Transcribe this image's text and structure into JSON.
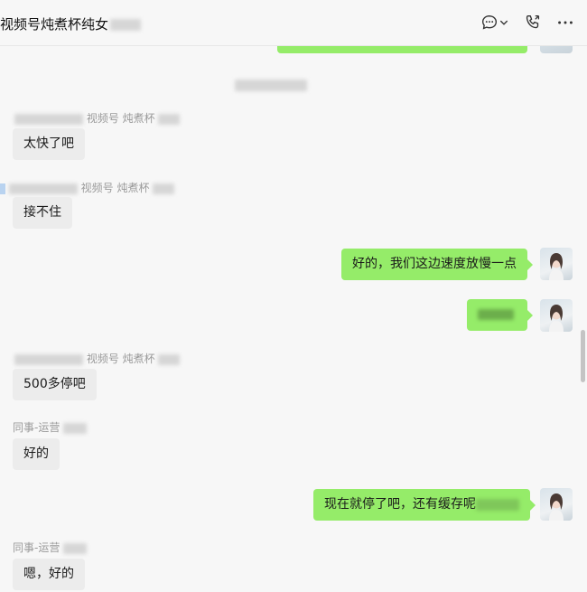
{
  "header": {
    "title": "视频号炖煮杯纯女",
    "icons": [
      "chat-icon",
      "chevron-down-icon",
      "call-icon",
      "more-icon"
    ]
  },
  "messages": [
    {
      "sender": "视频号 炖煮杯",
      "text": "太快了吧"
    },
    {
      "sender": "视频号 炖煮杯",
      "text": "接不住"
    },
    {
      "text": "好的，我们这边速度放慢一点"
    },
    {
      "sender": "视频号 炖煮杯",
      "text": "500多停吧"
    },
    {
      "sender": "同事-运营",
      "text": "好的"
    },
    {
      "text": "现在就停了吧，还有缓存呢"
    },
    {
      "sender": "同事-运营",
      "text": "嗯，好的"
    }
  ],
  "colors": {
    "background": "#f7f7f7",
    "outgoing_bubble": "#95ec69",
    "incoming_bubble": "#ececec",
    "sender_text": "#9a9a9a"
  }
}
